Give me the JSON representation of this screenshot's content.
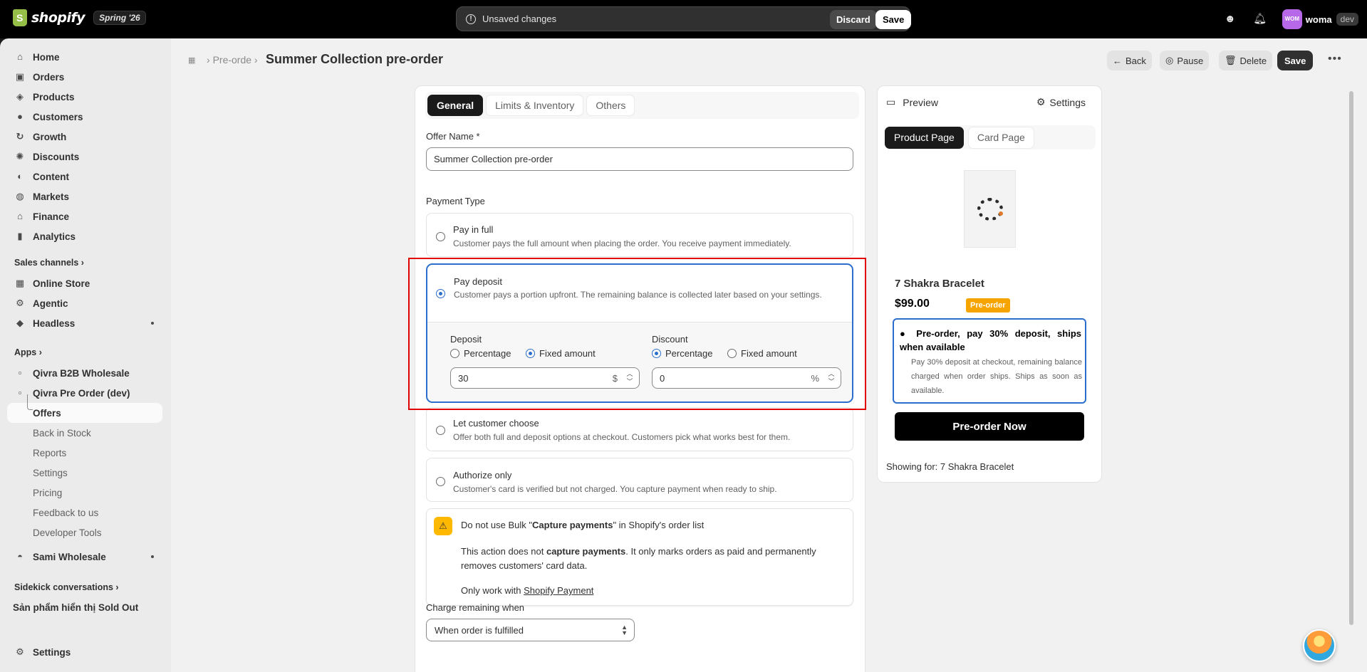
{
  "topbar": {
    "logo_text": "shopify",
    "edition": "Spring '26",
    "unsaved_message": "Unsaved changes",
    "discard_label": "Discard",
    "save_label": "Save",
    "avatar_initials": "WOM",
    "store_name": "woma",
    "store_tag": "dev"
  },
  "sidebar": {
    "main_items": [
      {
        "label": "Home",
        "icon": "home-icon"
      },
      {
        "label": "Orders",
        "icon": "orders-icon"
      },
      {
        "label": "Products",
        "icon": "tag-icon"
      },
      {
        "label": "Customers",
        "icon": "person-icon"
      },
      {
        "label": "Growth",
        "icon": "growth-icon"
      },
      {
        "label": "Discounts",
        "icon": "discount-icon"
      },
      {
        "label": "Content",
        "icon": "content-icon"
      },
      {
        "label": "Markets",
        "icon": "globe-icon"
      },
      {
        "label": "Finance",
        "icon": "bank-icon"
      },
      {
        "label": "Analytics",
        "icon": "bar-chart-icon"
      }
    ],
    "sales_channels_heading": "Sales channels",
    "sales_channels": [
      {
        "label": "Online Store",
        "icon": "store-icon"
      },
      {
        "label": "Agentic",
        "icon": "agentic-icon"
      },
      {
        "label": "Headless",
        "icon": "layers-icon"
      }
    ],
    "apps_heading": "Apps",
    "apps": [
      {
        "label": "Qivra B2B Wholesale"
      },
      {
        "label": "Qivra Pre Order (dev)"
      }
    ],
    "app_subitems": [
      "Offers",
      "Back in Stock",
      "Reports",
      "Settings",
      "Pricing",
      "Feedback to us",
      "Developer Tools"
    ],
    "other_app": "Sami Wholesale",
    "sidekick_heading": "Sidekick conversations",
    "sidekick_item": "Sản phẩm hiển thị Sold Out",
    "settings_label": "Settings"
  },
  "header": {
    "breadcrumb": "Pre-orde",
    "title": "Summer Collection pre-order",
    "back_label": "Back",
    "pause_label": "Pause",
    "delete_label": "Delete",
    "save_label": "Save"
  },
  "form": {
    "tabs": [
      "General",
      "Limits & Inventory",
      "Others"
    ],
    "offer_name_label": "Offer Name *",
    "offer_name_value": "Summer Collection pre-order",
    "payment_type_label": "Payment Type",
    "payment_types": [
      {
        "title": "Pay in full",
        "desc": "Customer pays the full amount when placing the order. You receive payment immediately."
      },
      {
        "title": "Pay deposit",
        "desc": "Customer pays a portion upfront. The remaining balance is collected later based on your settings."
      },
      {
        "title": "Let customer choose",
        "desc": "Offer both full and deposit options at checkout. Customers pick what works best for them."
      },
      {
        "title": "Authorize only",
        "desc": "Customer's card is verified but not charged. You capture payment when ready to ship."
      }
    ],
    "selected_payment_type": "Pay deposit",
    "deposit": {
      "label": "Deposit",
      "options": [
        "Percentage",
        "Fixed amount"
      ],
      "selected": "Fixed amount",
      "value": "30",
      "suffix": "$"
    },
    "discount": {
      "label": "Discount",
      "options": [
        "Percentage",
        "Fixed amount"
      ],
      "selected": "Percentage",
      "value": "0",
      "suffix": "%"
    },
    "warning": {
      "title_pre": "Do not use Bulk \"",
      "title_bold": "Capture payments",
      "title_post": "\" in Shopify's order list",
      "body_pre": "This action does not ",
      "body_bold": "capture payments",
      "body_post": ". It only marks orders as paid and permanently removes customers' card data.",
      "foot_pre": "Only work with ",
      "foot_link": "Shopify Payment"
    },
    "charge_label": "Charge remaining when",
    "charge_value": "When order is fulfilled"
  },
  "preview": {
    "preview_label": "Preview",
    "settings_label": "Settings",
    "tabs": [
      "Product Page",
      "Card Page"
    ],
    "product_name": "7 Shakra Bracelet",
    "price": "$99.00",
    "badge": "Pre-order",
    "offer_title": "Pre-order, pay 30% deposit, ships when available",
    "offer_desc": "Pay 30% deposit at checkout, remaining balance charged when order ships. Ships as soon as available.",
    "button_label": "Pre-order Now",
    "showing_for": "Showing for: 7 Shakra Bracelet"
  },
  "colors": {
    "accent_blue": "#2c6ecb",
    "highlight_red": "#e00000",
    "badge_orange": "#f5a400",
    "warning_yellow": "#ffb800"
  }
}
